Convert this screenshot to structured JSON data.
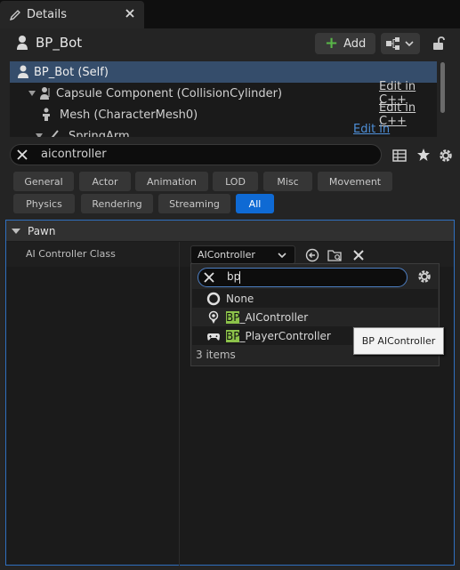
{
  "tab": {
    "title": "Details"
  },
  "header": {
    "object_name": "BP_Bot",
    "add_label": "Add"
  },
  "components": [
    {
      "label": "BP_Bot (Self)"
    },
    {
      "label": "Capsule Component (CollisionCylinder)",
      "action": "Edit in C++"
    },
    {
      "label": "Mesh (CharacterMesh0)",
      "action": "Edit in C++"
    },
    {
      "label": "SpringArm",
      "action": "Edit in Blueprint"
    }
  ],
  "search": {
    "value": "aicontroller"
  },
  "filters": [
    "General",
    "Actor",
    "Animation",
    "LOD",
    "Misc",
    "Movement",
    "Physics",
    "Rendering",
    "Streaming",
    "All"
  ],
  "active_filter": "All",
  "section": {
    "title": "Pawn"
  },
  "property": {
    "label": "AI Controller Class",
    "value": "AIController"
  },
  "picker": {
    "search_value": "bp",
    "items": [
      {
        "label": "None",
        "match": "",
        "rest": "None"
      },
      {
        "label": "BP_AIController",
        "match": "BP",
        "rest": "_AIController"
      },
      {
        "label": "BP_PlayerController",
        "match": "BP",
        "rest": "_PlayerController"
      }
    ],
    "count_text": "3 items"
  },
  "tooltip": {
    "text": "BP AIController"
  },
  "colors": {
    "accent": "#0f6ad4",
    "selection": "#354d6b",
    "highlight": "#8cc24a",
    "add_plus": "#59b748"
  }
}
